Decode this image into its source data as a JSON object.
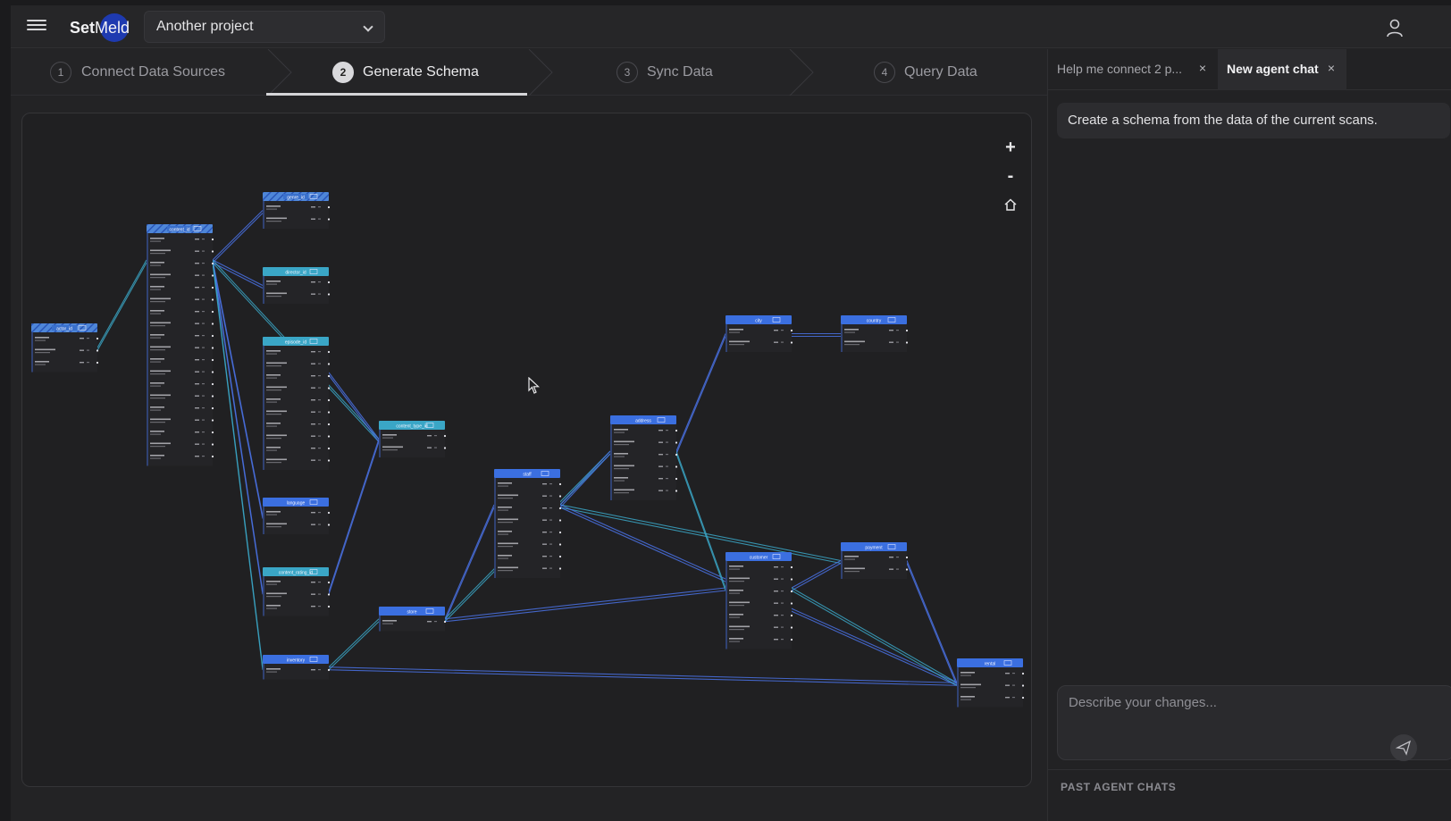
{
  "app": {
    "logo_text": "SetMeld",
    "logo_pre": "Set",
    "logo_post": "Meld"
  },
  "project_select": {
    "value": "Another project"
  },
  "stepper": {
    "steps": [
      {
        "number": "1",
        "label": "Connect Data Sources"
      },
      {
        "number": "2",
        "label": "Generate Schema"
      },
      {
        "number": "3",
        "label": "Sync Data"
      },
      {
        "number": "4",
        "label": "Query Data"
      }
    ],
    "active_index": 1
  },
  "canvas": {
    "zoom_in_label": "+",
    "zoom_out_label": "-",
    "tables": [
      {
        "name": "actor_id",
        "style": "hatched"
      },
      {
        "name": "content_id",
        "style": "hatched"
      },
      {
        "name": "genre_id",
        "style": "hatched"
      },
      {
        "name": "director_id",
        "style": "teal"
      },
      {
        "name": "episode_id",
        "style": "teal"
      },
      {
        "name": "content_type_id",
        "style": "teal"
      },
      {
        "name": "language",
        "style": "blue"
      },
      {
        "name": "content_rating_id",
        "style": "teal"
      },
      {
        "name": "inventory",
        "style": "blue"
      },
      {
        "name": "store",
        "style": "blue"
      },
      {
        "name": "staff",
        "style": "blue"
      },
      {
        "name": "address",
        "style": "blue"
      },
      {
        "name": "city",
        "style": "blue"
      },
      {
        "name": "country",
        "style": "blue"
      },
      {
        "name": "customer",
        "style": "blue"
      },
      {
        "name": "payment",
        "style": "blue"
      },
      {
        "name": "rental",
        "style": "blue"
      }
    ]
  },
  "colors": {
    "blue": "#3b6fe0",
    "teal": "#3aa6c6",
    "hatched": "#4e86d8"
  },
  "panel": {
    "tabs": [
      {
        "label": "Help me connect 2 p...",
        "active": false
      },
      {
        "label": "New agent chat",
        "active": true
      }
    ],
    "close_glyph": "×",
    "message": "Create a schema from the data of the current scans.",
    "composer_placeholder": "Describe your changes...",
    "past_chats_heading": "PAST AGENT CHATS"
  },
  "icons": {
    "menu": "menu-icon",
    "chevron": "chevron-down-icon",
    "user": "user-icon",
    "send": "send-icon",
    "home": "home-icon",
    "cursor": "cursor-icon"
  }
}
